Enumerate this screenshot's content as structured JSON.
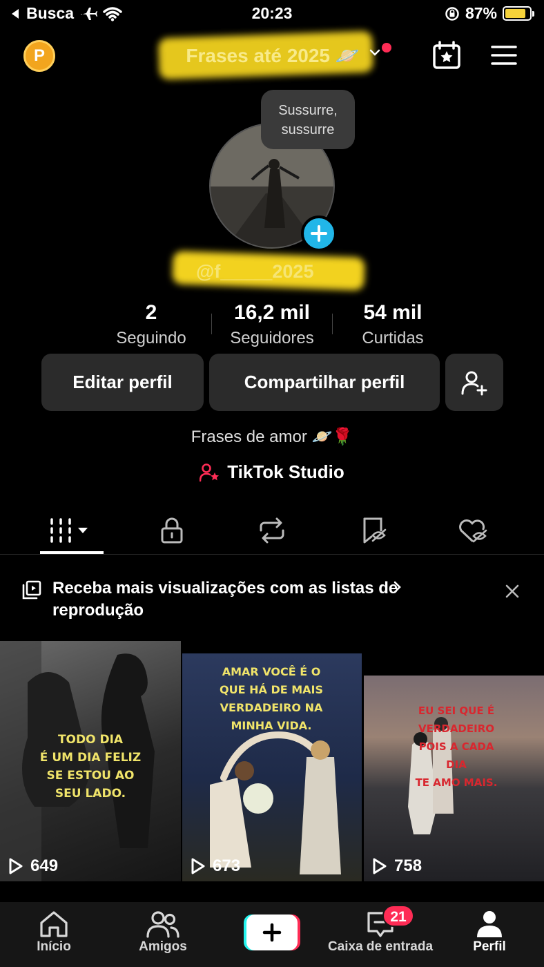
{
  "status_bar": {
    "back_app": "Busca",
    "time": "20:23",
    "battery": "87%"
  },
  "header": {
    "coin_letter": "P",
    "title": "Frases até 2025 🪐"
  },
  "profile": {
    "bubble": "Sussurre, sussurre",
    "handle": "@f_____2025",
    "stats": [
      {
        "value": "2",
        "label": "Seguindo"
      },
      {
        "value": "16,2 mil",
        "label": "Seguidores"
      },
      {
        "value": "54 mil",
        "label": "Curtidas"
      }
    ],
    "edit_label": "Editar perfil",
    "share_label": "Compartilhar perfil",
    "bio": "Frases de amor 🪐🌹",
    "studio_label": "TikTok Studio"
  },
  "banner": {
    "text": "Receba mais visualizações com as listas de reprodução"
  },
  "videos": [
    {
      "caption": "TODO DIA\nÉ UM DIA FELIZ\nSE ESTOU AO\nSEU LADO.",
      "views": "649"
    },
    {
      "caption": "AMAR VOCÊ É O\nQUE HÁ DE MAIS\nVERDADEIRO NA\nMINHA VIDA.",
      "views": "673"
    },
    {
      "caption": "EU SEI QUE É\nVERDADEIRO\nPOIS A CADA\nDIA\nTE AMO MAIS.",
      "views": "758"
    }
  ],
  "nav": {
    "home": "Início",
    "friends": "Amigos",
    "inbox": "Caixa de entrada",
    "inbox_badge": "21",
    "profile": "Perfil"
  },
  "colors": {
    "accent_red": "#fe2c55",
    "accent_cyan": "#25f4ee",
    "highlight_yellow": "#f2d21f"
  }
}
